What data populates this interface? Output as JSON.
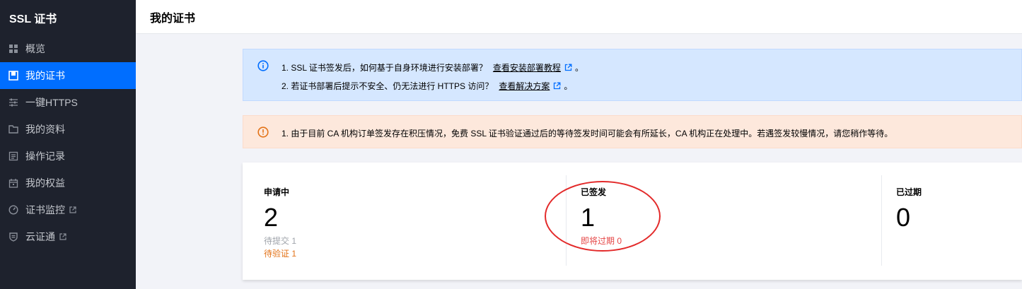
{
  "sidebar": {
    "title": "SSL 证书",
    "items": [
      {
        "label": "概览",
        "icon": "grid-icon"
      },
      {
        "label": "我的证书",
        "icon": "certificate-icon",
        "active": true
      },
      {
        "label": "一键HTTPS",
        "icon": "sliders-icon"
      },
      {
        "label": "我的资料",
        "icon": "folder-icon"
      },
      {
        "label": "操作记录",
        "icon": "list-icon"
      },
      {
        "label": "我的权益",
        "icon": "calendar-icon"
      },
      {
        "label": "证书监控",
        "icon": "gauge-icon",
        "external": true
      },
      {
        "label": "云证通",
        "icon": "shield-icon",
        "external": true
      }
    ]
  },
  "header": {
    "title": "我的证书"
  },
  "info_notice": {
    "line1_text": "1. SSL 证书签发后，如何基于自身环境进行安装部署？",
    "line1_link": "查看安装部署教程",
    "line2_text": "2. 若证书部署后提示不安全、仍无法进行 HTTPS 访问？",
    "line2_link": "查看解决方案",
    "period": "。"
  },
  "warning_notice": {
    "text": "1. 由于目前 CA 机构订单签发存在积压情况，免费 SSL 证书验证通过后的等待签发时间可能会有所延长，CA 机构正在处理中。若遇签发较慢情况，请您稍作等待。"
  },
  "stats": {
    "applying": {
      "label": "申请中",
      "count": "2",
      "sub1": "待提交 1",
      "sub2": "待验证 1"
    },
    "issued": {
      "label": "已签发",
      "count": "1",
      "sub1": "即将过期 0"
    },
    "expired": {
      "label": "已过期",
      "count": "0"
    }
  },
  "colors": {
    "sidebar_bg": "#1e222d",
    "active": "#006eff",
    "info_bg": "#d5e7ff",
    "warn_bg": "#fde8dc",
    "pending_orange": "#e37318",
    "expiring_red": "#e54545",
    "annotation_red": "#e32a2a"
  }
}
